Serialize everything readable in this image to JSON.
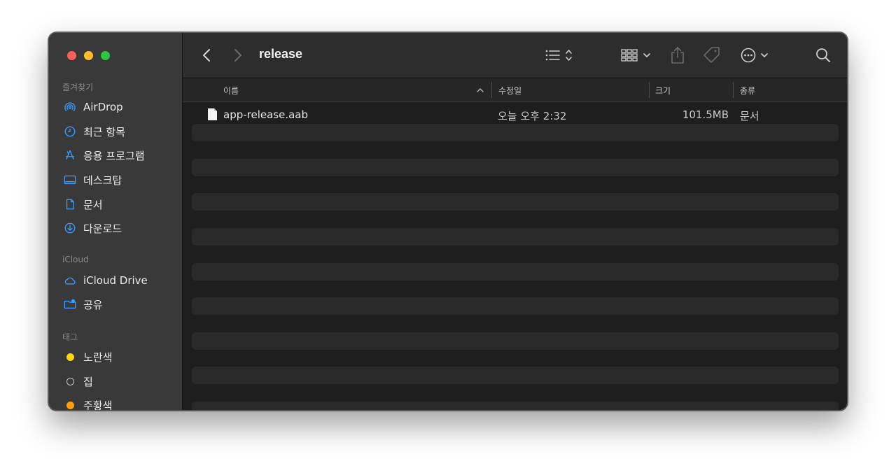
{
  "window": {
    "title": "release"
  },
  "sidebar": {
    "favorites_header": "즐겨찾기",
    "favorites": [
      {
        "label": "AirDrop",
        "icon": "airdrop-icon"
      },
      {
        "label": "최근 항목",
        "icon": "clock-icon"
      },
      {
        "label": "응용 프로그램",
        "icon": "applications-icon"
      },
      {
        "label": "데스크탑",
        "icon": "desktop-icon"
      },
      {
        "label": "문서",
        "icon": "document-icon"
      },
      {
        "label": "다운로드",
        "icon": "download-icon"
      }
    ],
    "icloud_header": "iCloud",
    "icloud": [
      {
        "label": "iCloud Drive",
        "icon": "cloud-icon"
      },
      {
        "label": "공유",
        "icon": "shared-folder-icon"
      }
    ],
    "tags_header": "태그",
    "tags": [
      {
        "label": "노란색",
        "color": "#ffd60a"
      },
      {
        "label": "집",
        "color": "none"
      },
      {
        "label": "주황색",
        "color": "#ff9f0a"
      }
    ]
  },
  "columns": {
    "name": "이름",
    "modified": "수정일",
    "size": "크기",
    "kind": "종류"
  },
  "files": [
    {
      "name": "app-release.aab",
      "modified": "오늘 오후 2:32",
      "size": "101.5MB",
      "kind": "문서",
      "icon": "file-icon"
    }
  ],
  "colors": {
    "accent": "#3b9bff",
    "sidebar_bg": "#393939",
    "content_bg": "#1e1e1e"
  }
}
